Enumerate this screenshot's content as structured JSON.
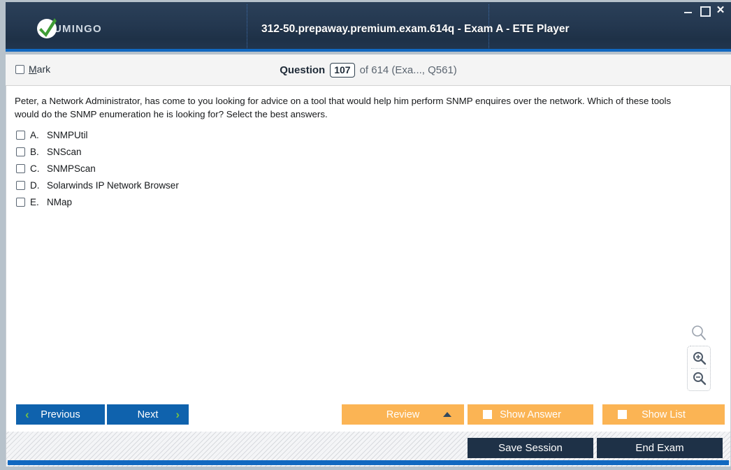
{
  "window": {
    "title": "312-50.prepaway.premium.exam.614q - Exam A - ETE Player",
    "logo_text": "UMINGO",
    "controls": {
      "minimize": "minimize",
      "maximize": "maximize",
      "close": "✕"
    }
  },
  "question_bar": {
    "mark_label_prefix": "M",
    "mark_label_rest": "ark",
    "question_word": "Question",
    "question_number": "107",
    "of_text": "of 614 (Exa..., Q561)"
  },
  "question": {
    "text": "Peter, a Network Administrator, has come to you looking for advice on a tool that would help him perform SNMP enquires over the network. Which of these tools would do the SNMP enumeration he is looking for? Select the best answers.",
    "options": [
      {
        "letter": "A.",
        "text": "SNMPUtil",
        "checked": false
      },
      {
        "letter": "B.",
        "text": "SNScan",
        "checked": false
      },
      {
        "letter": "C.",
        "text": "SNMPScan",
        "checked": false
      },
      {
        "letter": "D.",
        "text": "Solarwinds IP Network Browser",
        "checked": false
      },
      {
        "letter": "E.",
        "text": "NMap",
        "checked": false
      }
    ]
  },
  "zoom_tools": {
    "handle_icon": "magnifier-icon",
    "zoom_in_icon": "zoom-in-icon",
    "zoom_out_icon": "zoom-out-icon"
  },
  "toolbar": {
    "previous_label": "Previous",
    "next_label": "Next",
    "prev_chevron": "‹",
    "next_chevron": "›",
    "review_label": "Review",
    "show_answer_label": "Show Answer",
    "show_list_label": "Show List"
  },
  "footer": {
    "save_session_label": "Save Session",
    "end_exam_label": "End Exam"
  },
  "colors": {
    "header_dark": "#243850",
    "accent_blue": "#1168c0",
    "nav_blue": "#0f62ad",
    "chevron_green": "#76c043",
    "orange": "#fbb454",
    "footer_dark": "#1e3147"
  }
}
